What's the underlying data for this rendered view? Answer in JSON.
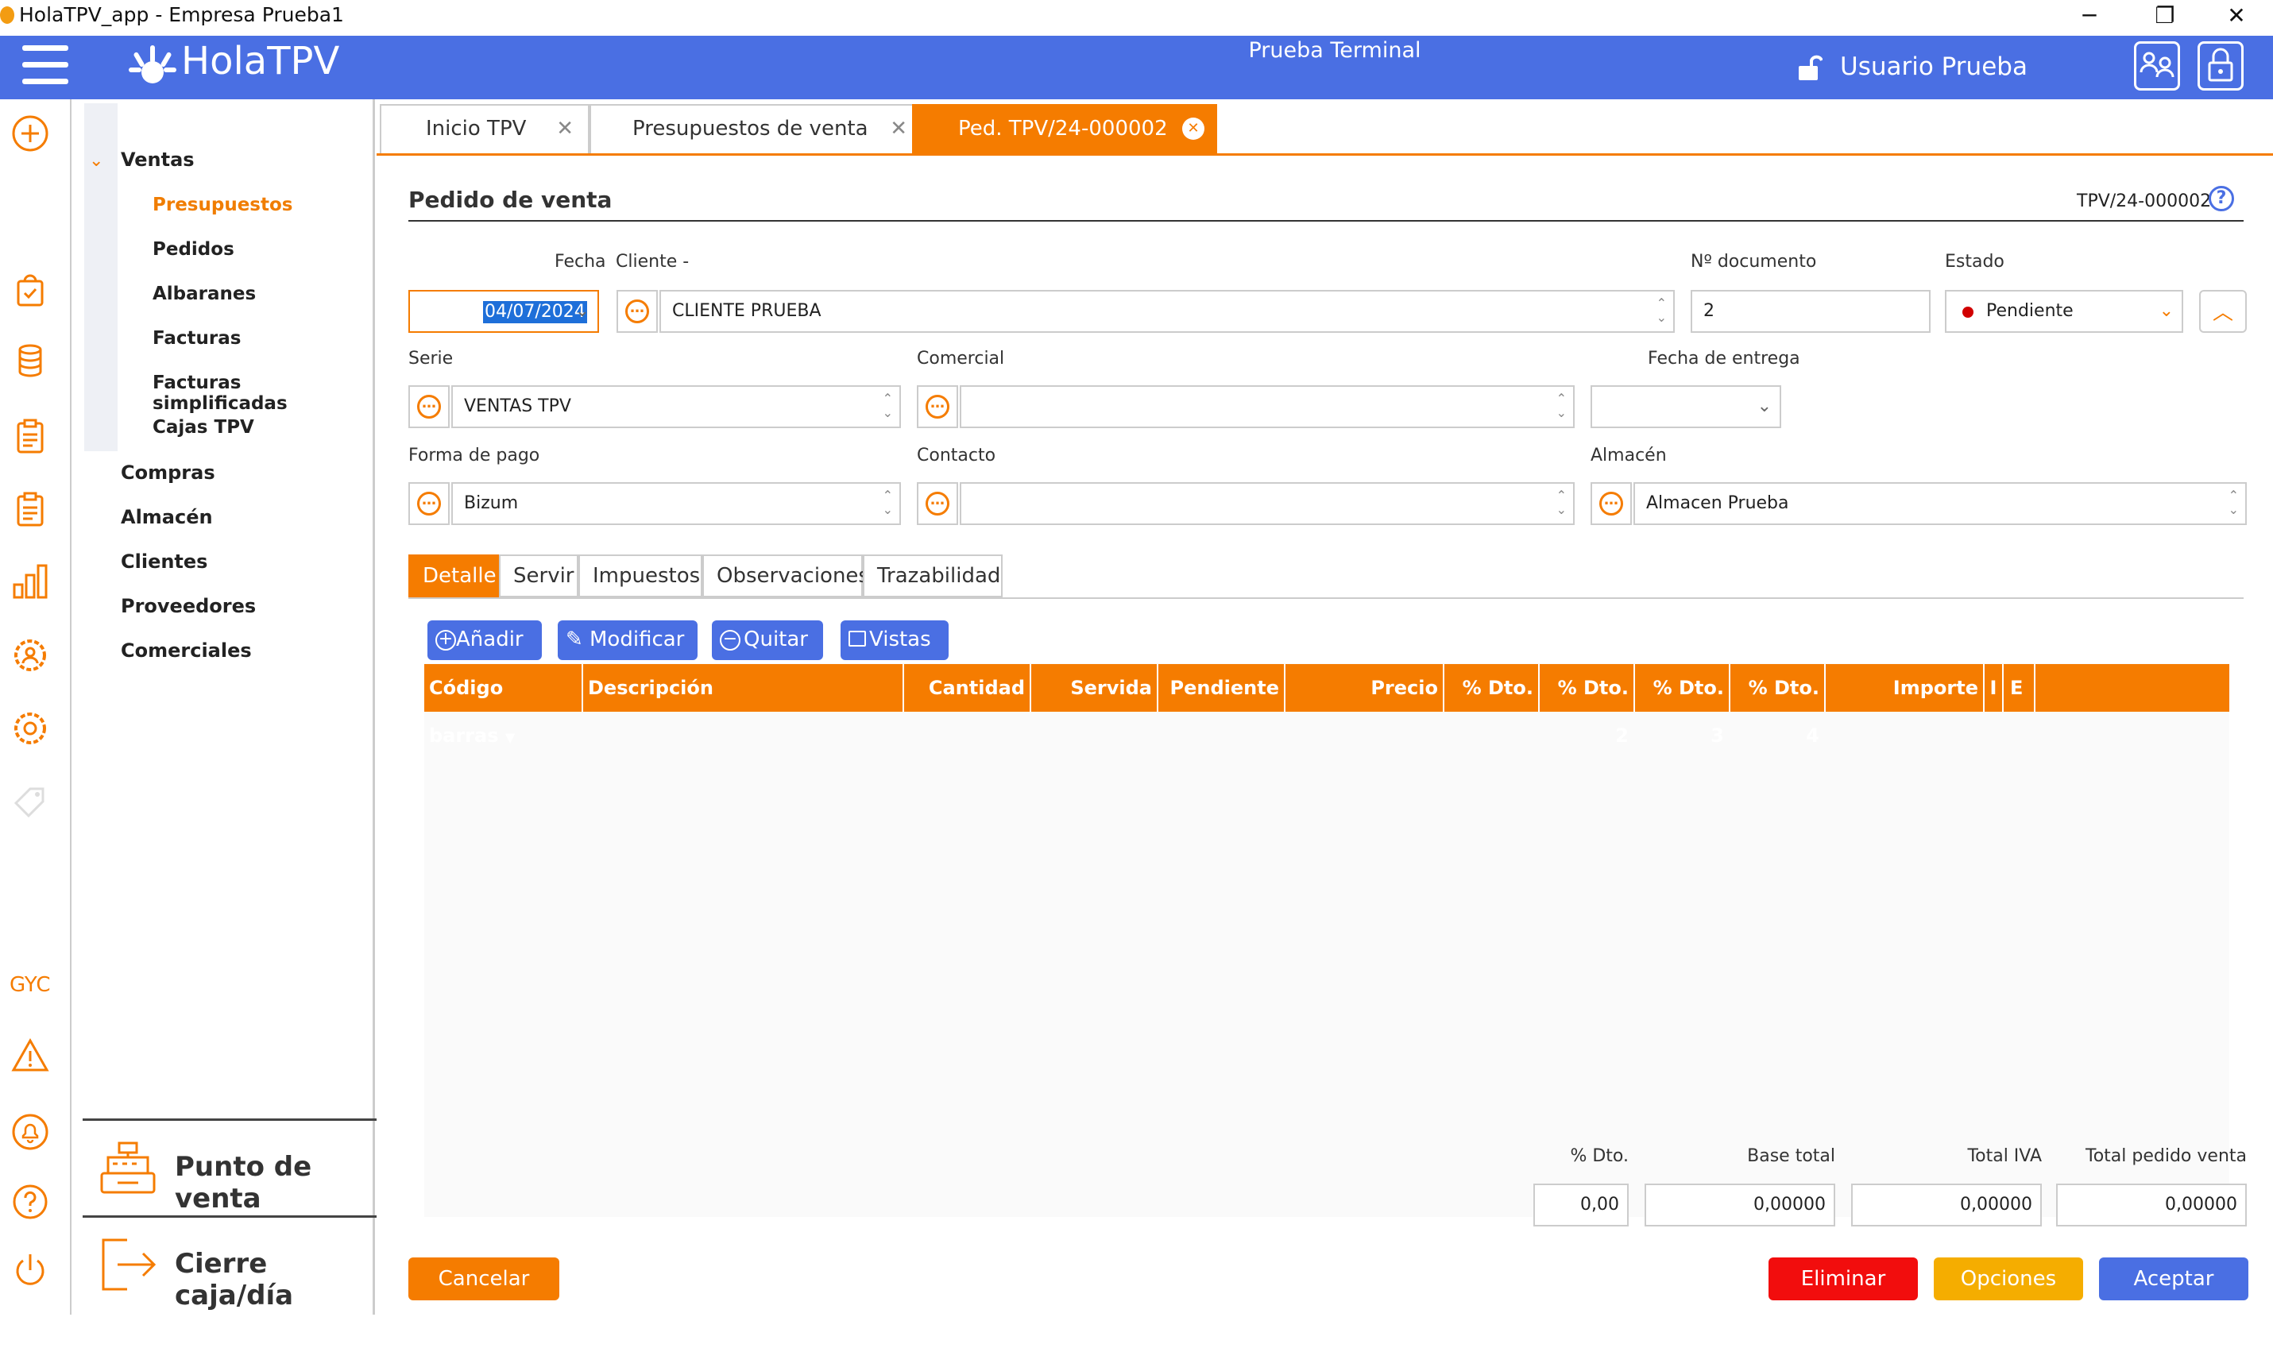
{
  "window": {
    "title": "HolaTPV_app - Empresa Prueba1",
    "minimize": "─",
    "restore": "❐",
    "close": "✕"
  },
  "header": {
    "logo": "HolaTPV",
    "terminal": "Prueba Terminal",
    "user": "Usuario Prueba",
    "bg_color": "#4a6fe3"
  },
  "nav": {
    "ventas": "Ventas",
    "ventas_items": [
      "Presupuestos",
      "Pedidos",
      "Albaranes",
      "Facturas",
      "Facturas simplificadas",
      "Cajas TPV"
    ],
    "sections": [
      "Compras",
      "Almacén",
      "Clientes",
      "Proveedores",
      "Comerciales"
    ],
    "punto_venta": "Punto de venta",
    "cierre": "Cierre caja/día",
    "gyc": "GYC"
  },
  "tabs": [
    {
      "label": "Inicio TPV"
    },
    {
      "label": "Presupuestos de venta"
    },
    {
      "label": "Ped. TPV/24-000002"
    }
  ],
  "form": {
    "title": "Pedido de venta",
    "doc_code": "TPV/24-000002",
    "help": "?",
    "fecha_label": "Fecha",
    "fecha_value": "04/07/2024",
    "cliente_label": "Cliente  -",
    "cliente_value": "CLIENTE PRUEBA",
    "ndoc_label": "Nº documento",
    "ndoc_value": "2",
    "estado_label": "Estado",
    "estado_value": "Pendiente",
    "serie_label": "Serie",
    "serie_value": "VENTAS TPV",
    "comercial_label": "Comercial",
    "comercial_value": "",
    "fecha_entrega_label": "Fecha de entrega",
    "fecha_entrega_value": "",
    "forma_pago_label": "Forma de pago",
    "forma_pago_value": "Bizum",
    "contacto_label": "Contacto",
    "contacto_value": "",
    "almacen_label": "Almacén",
    "almacen_value": "Almacen Prueba"
  },
  "subtabs": [
    "Detalle",
    "Servir",
    "Impuestos",
    "Observaciones",
    "Trazabilidad"
  ],
  "actions": [
    "Añadir",
    "Modificar",
    "Quitar",
    "Vistas"
  ],
  "grid_columns": [
    "Código barras",
    "Descripción",
    "Cantidad",
    "Servida",
    "Pendiente",
    "Precio",
    "% Dto.",
    "% Dto. 2",
    "% Dto. 3",
    "% Dto. 4",
    "Importe",
    "I",
    "E"
  ],
  "totals": {
    "dto_label": "% Dto.",
    "dto_value": "0,00",
    "base_label": "Base total",
    "base_value": "0,00000",
    "iva_label": "Total IVA",
    "iva_value": "0,00000",
    "total_label": "Total pedido venta",
    "total_value": "0,00000"
  },
  "buttons": {
    "cancelar": "Cancelar",
    "eliminar": "Eliminar",
    "opciones": "Opciones",
    "aceptar": "Aceptar"
  },
  "colors": {
    "accent": "#f57c00",
    "blue": "#4a6fe3",
    "red": "#f20d0d",
    "yellow": "#f5ad00"
  }
}
